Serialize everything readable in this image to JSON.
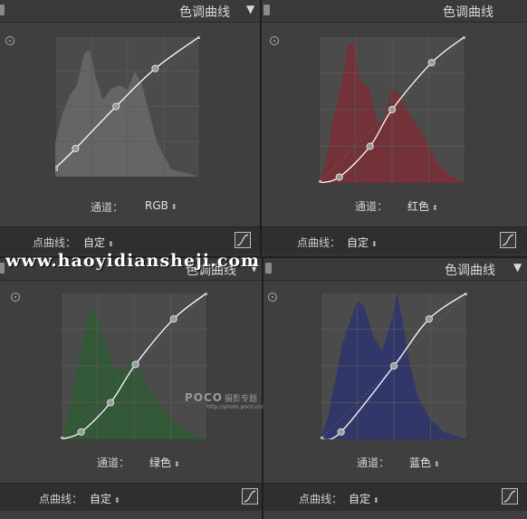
{
  "panels": [
    {
      "id": "rgb",
      "title": "色调曲线",
      "channel_label": "通道：",
      "channel_value": "RGB",
      "point_curve_label": "点曲线：",
      "point_curve_value": "自定",
      "curve_color": "#ffffff",
      "histogram_color": "#6a6a6a",
      "curve_points": [
        [
          0,
          0.06
        ],
        [
          0.14,
          0.2
        ],
        [
          0.42,
          0.5
        ],
        [
          0.69,
          0.77
        ],
        [
          1,
          1
        ]
      ]
    },
    {
      "id": "red",
      "title": "色调曲线",
      "channel_label": "通道：",
      "channel_value": "红色",
      "point_curve_label": "点曲线：",
      "point_curve_value": "自定",
      "curve_color": "#ffffff",
      "histogram_color": "#7a2e34",
      "curve_points": [
        [
          0,
          0
        ],
        [
          0.14,
          0.04
        ],
        [
          0.35,
          0.25
        ],
        [
          0.5,
          0.5
        ],
        [
          0.77,
          0.82
        ],
        [
          1,
          1
        ]
      ]
    },
    {
      "id": "green",
      "title": "色调曲线",
      "channel_label": "通道：",
      "channel_value": "绿色",
      "point_curve_label": "点曲线：",
      "point_curve_value": "自定",
      "curve_color": "#ffffff",
      "histogram_color": "#2f5a34",
      "curve_points": [
        [
          0,
          0
        ],
        [
          0.14,
          0.05
        ],
        [
          0.34,
          0.25
        ],
        [
          0.51,
          0.51
        ],
        [
          0.77,
          0.82
        ],
        [
          1,
          1
        ]
      ]
    },
    {
      "id": "blue",
      "title": "色调曲线",
      "channel_label": "通道：",
      "channel_value": "蓝色",
      "point_curve_label": "点曲线：",
      "point_curve_value": "自定",
      "curve_color": "#ffffff",
      "histogram_color": "#2e3470",
      "curve_points": [
        [
          0,
          0
        ],
        [
          0.14,
          0.05
        ],
        [
          0.5,
          0.5
        ],
        [
          0.74,
          0.82
        ],
        [
          1,
          1
        ]
      ]
    }
  ],
  "watermark": "www.haoyidiansheji.com",
  "poco": {
    "logo": "POCO",
    "tag": "摄影专题",
    "url": "http://photo.poco.cn/"
  },
  "icons": [
    "target-adjust-icon",
    "point-curve-edit-icon",
    "collapse-triangle-icon",
    "panel-grip-icon",
    "spinner-arrows-icon"
  ]
}
